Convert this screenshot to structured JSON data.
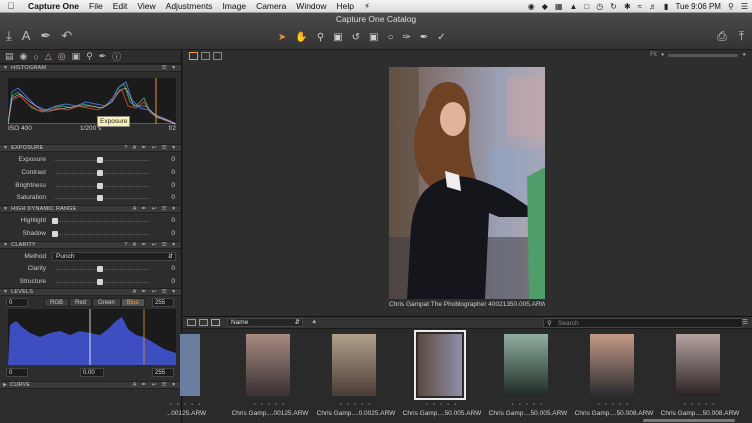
{
  "menubar": {
    "apple": "",
    "app": "Capture One",
    "items": [
      "File",
      "Edit",
      "View",
      "Adjustments",
      "Image",
      "Camera",
      "Window",
      "Help"
    ],
    "clock": "Tue 9:06 PM"
  },
  "window": {
    "title": "Capture One Catalog"
  },
  "histogram": {
    "section": "HISTOGRAM",
    "iso": "ISO 400",
    "shutter": "1/200 s",
    "aperture": "f/2"
  },
  "exposure": {
    "section": "EXPOSURE",
    "rows": [
      {
        "label": "Exposure",
        "value": "0",
        "pos": 0.5
      },
      {
        "label": "Contrast",
        "value": "0",
        "pos": 0.5
      },
      {
        "label": "Brightness",
        "value": "0",
        "pos": 0.5
      },
      {
        "label": "Saturation",
        "value": "0",
        "pos": 0.5
      }
    ],
    "tooltip": "Exposure"
  },
  "hdr": {
    "section": "HIGH DYNAMIC RANGE",
    "rows": [
      {
        "label": "Highlight",
        "value": "0",
        "pos": 0.0
      },
      {
        "label": "Shadow",
        "value": "0",
        "pos": 0.0
      }
    ]
  },
  "clarity": {
    "section": "CLARITY",
    "method_label": "Method",
    "method_value": "Punch",
    "rows": [
      {
        "label": "Clarity",
        "value": "0",
        "pos": 0.5
      },
      {
        "label": "Structure",
        "value": "0",
        "pos": 0.5
      }
    ]
  },
  "levels": {
    "section": "LEVELS",
    "in_low": "0",
    "in_high": "255",
    "channels": [
      "RGB",
      "Red",
      "Green",
      "Blue"
    ],
    "active_channel": "Blue",
    "out_low": "0",
    "mid": "0.00",
    "out_high": "255"
  },
  "curve": {
    "section": "CURVE"
  },
  "viewer": {
    "caption": "Chris Gampat The Phoblographer 40021350.005.ARW",
    "fit": "Fit"
  },
  "browser": {
    "sort": "Name",
    "search_placeholder": "Search",
    "thumbs": [
      {
        "name": "...00125.ARW",
        "selected": false
      },
      {
        "name": "Chris Gamp....00125.ARW",
        "selected": false
      },
      {
        "name": "Chris Gamp....0.0025.ARW",
        "selected": false
      },
      {
        "name": "Chris Gamp....50.005.ARW",
        "selected": true
      },
      {
        "name": "Chris Gamp....50.005.ARW",
        "selected": false
      },
      {
        "name": "Chris Gamp....50.008.ARW",
        "selected": false
      },
      {
        "name": "Chris Gamp....50.008.ARW",
        "selected": false
      }
    ]
  },
  "colors": {
    "accent": "#f09a3a",
    "panel": "#2d2d2d",
    "viewer": "#2e2e2e"
  }
}
